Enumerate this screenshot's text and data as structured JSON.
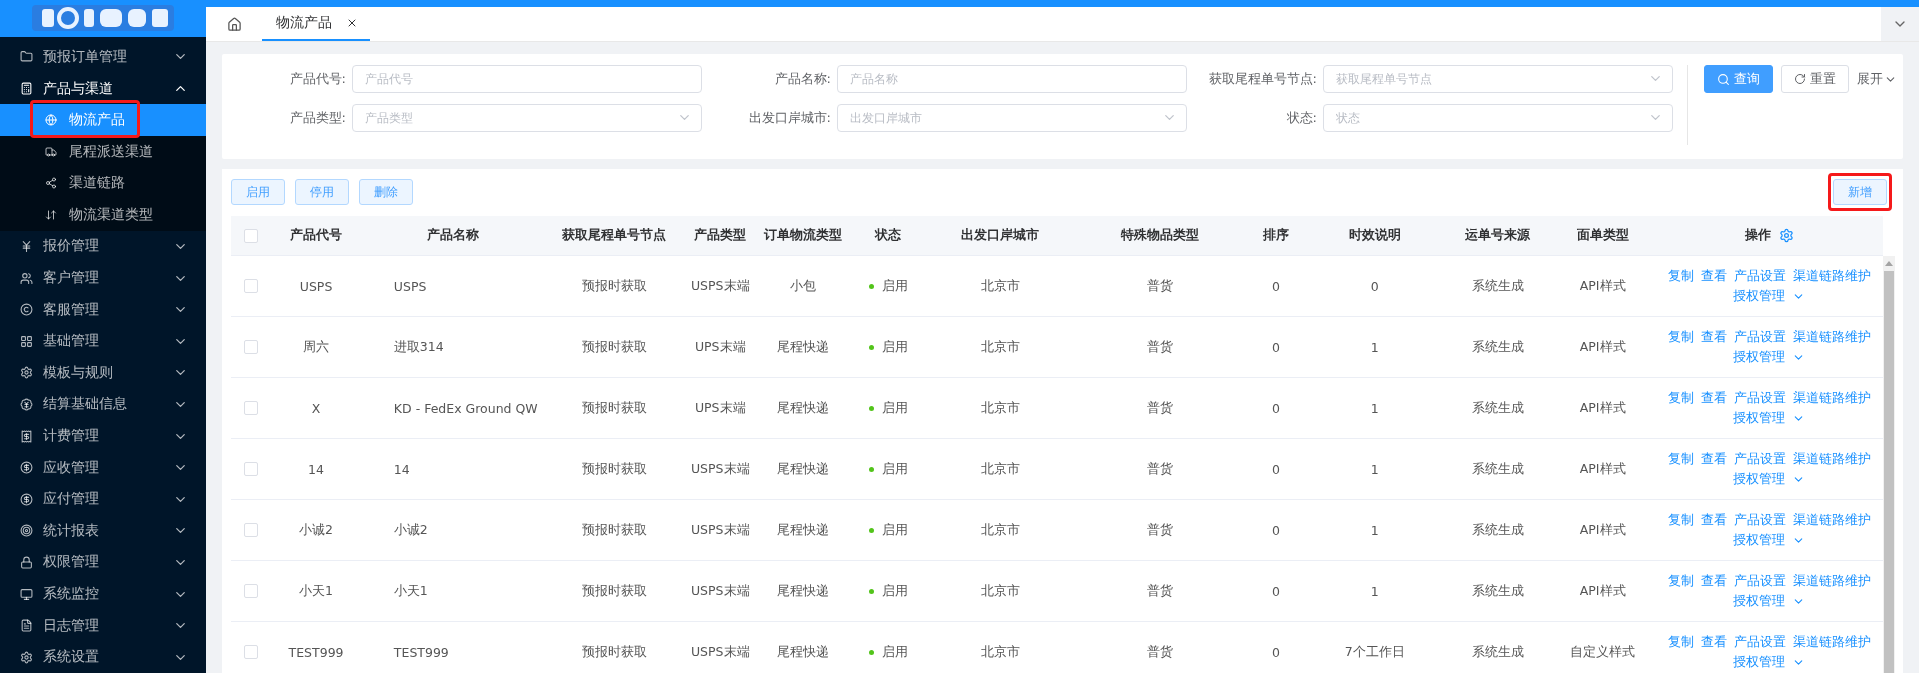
{
  "sidebar": {
    "items": [
      {
        "label": "预报订单管理",
        "expanded": false
      },
      {
        "label": "产品与渠道",
        "expanded": true,
        "children": [
          {
            "label": "物流产品",
            "selected": true,
            "highlighted": true
          },
          {
            "label": "尾程派送渠道",
            "selected": false,
            "highlighted": false
          },
          {
            "label": "渠道链路",
            "selected": false,
            "highlighted": false
          },
          {
            "label": "物流渠道类型",
            "selected": false,
            "highlighted": false
          }
        ]
      },
      {
        "label": "报价管理",
        "expanded": false
      },
      {
        "label": "客户管理",
        "expanded": false
      },
      {
        "label": "客服管理",
        "expanded": false
      },
      {
        "label": "基础管理",
        "expanded": false
      },
      {
        "label": "模板与规则",
        "expanded": false
      },
      {
        "label": "结算基础信息",
        "expanded": false
      },
      {
        "label": "计费管理",
        "expanded": false
      },
      {
        "label": "应收管理",
        "expanded": false
      },
      {
        "label": "应付管理",
        "expanded": false
      },
      {
        "label": "统计报表",
        "expanded": false
      },
      {
        "label": "权限管理",
        "expanded": false
      },
      {
        "label": "系统监控",
        "expanded": false
      },
      {
        "label": "日志管理",
        "expanded": false
      },
      {
        "label": "系统设置",
        "expanded": false
      }
    ]
  },
  "tabs": [
    {
      "label": "物流产品",
      "selected": true
    }
  ],
  "filters": [
    {
      "label": "产品代号:",
      "placeholder": "产品代号",
      "kind": "text"
    },
    {
      "label": "产品名称:",
      "placeholder": "产品名称",
      "kind": "text"
    },
    {
      "label": "获取尾程单号节点:",
      "placeholder": "获取尾程单号节点",
      "kind": "select"
    },
    {
      "label": "产品类型:",
      "placeholder": "产品类型",
      "kind": "select"
    },
    {
      "label": "出发口岸城市:",
      "placeholder": "出发口岸城市",
      "kind": "select"
    },
    {
      "label": "状态:",
      "placeholder": "状态",
      "kind": "select"
    }
  ],
  "search_actions": {
    "query": "查询",
    "reset": "重置",
    "expand": "展开"
  },
  "toolbar": {
    "buttons": [
      "启用",
      "停用",
      "删除"
    ],
    "add": {
      "label": "新增",
      "highlighted": true
    }
  },
  "table": {
    "header_checked": false,
    "columns": [
      "产品代号",
      "产品名称",
      "获取尾程单号节点",
      "产品类型",
      "订单物流类型",
      "状态",
      "出发口岸城市",
      "特殊物品类型",
      "排序",
      "时效说明",
      "运单号来源",
      "面单类型",
      "操作"
    ],
    "rows": [
      {
        "checked": false,
        "code": "USPS",
        "name": "USPS",
        "node": "预报时获取",
        "type": "USPS末端",
        "order_type": "小包",
        "status": {
          "label": "启用",
          "enabled": true
        },
        "city": "北京市",
        "special": "普货",
        "sort": "0",
        "timeliness": "0",
        "source": "系统生成",
        "label_type": "API样式",
        "actions": [
          "复制",
          "查看",
          "产品设置",
          "渠道链路维护",
          "授权管理"
        ]
      },
      {
        "checked": false,
        "code": "周六",
        "name": "进取314",
        "node": "预报时获取",
        "type": "UPS末端",
        "order_type": "尾程快递",
        "status": {
          "label": "启用",
          "enabled": true
        },
        "city": "北京市",
        "special": "普货",
        "sort": "0",
        "timeliness": "1",
        "source": "系统生成",
        "label_type": "API样式",
        "actions": [
          "复制",
          "查看",
          "产品设置",
          "渠道链路维护",
          "授权管理"
        ]
      },
      {
        "checked": false,
        "code": "X",
        "name": "KD - FedEx Ground QW",
        "node": "预报时获取",
        "type": "UPS末端",
        "order_type": "尾程快递",
        "status": {
          "label": "启用",
          "enabled": true
        },
        "city": "北京市",
        "special": "普货",
        "sort": "0",
        "timeliness": "1",
        "source": "系统生成",
        "label_type": "API样式",
        "actions": [
          "复制",
          "查看",
          "产品设置",
          "渠道链路维护",
          "授权管理"
        ]
      },
      {
        "checked": false,
        "code": "14",
        "name": "14",
        "node": "预报时获取",
        "type": "USPS末端",
        "order_type": "尾程快递",
        "status": {
          "label": "启用",
          "enabled": true
        },
        "city": "北京市",
        "special": "普货",
        "sort": "0",
        "timeliness": "1",
        "source": "系统生成",
        "label_type": "API样式",
        "actions": [
          "复制",
          "查看",
          "产品设置",
          "渠道链路维护",
          "授权管理"
        ]
      },
      {
        "checked": false,
        "code": "小诚2",
        "name": "小诚2",
        "node": "预报时获取",
        "type": "USPS末端",
        "order_type": "尾程快递",
        "status": {
          "label": "启用",
          "enabled": true
        },
        "city": "北京市",
        "special": "普货",
        "sort": "0",
        "timeliness": "1",
        "source": "系统生成",
        "label_type": "API样式",
        "actions": [
          "复制",
          "查看",
          "产品设置",
          "渠道链路维护",
          "授权管理"
        ]
      },
      {
        "checked": false,
        "code": "小天1",
        "name": "小天1",
        "node": "预报时获取",
        "type": "USPS末端",
        "order_type": "尾程快递",
        "status": {
          "label": "启用",
          "enabled": true
        },
        "city": "北京市",
        "special": "普货",
        "sort": "0",
        "timeliness": "1",
        "source": "系统生成",
        "label_type": "API样式",
        "actions": [
          "复制",
          "查看",
          "产品设置",
          "渠道链路维护",
          "授权管理"
        ]
      },
      {
        "checked": false,
        "code": "TEST999",
        "name": "TEST999",
        "node": "预报时获取",
        "type": "USPS末端",
        "order_type": "尾程快递",
        "status": {
          "label": "启用",
          "enabled": true
        },
        "city": "北京市",
        "special": "普货",
        "sort": "0",
        "timeliness": "7个工作日",
        "source": "系统生成",
        "label_type": "自定义样式",
        "actions": [
          "复制",
          "查看",
          "产品设置",
          "渠道链路维护",
          "授权管理"
        ]
      }
    ]
  }
}
